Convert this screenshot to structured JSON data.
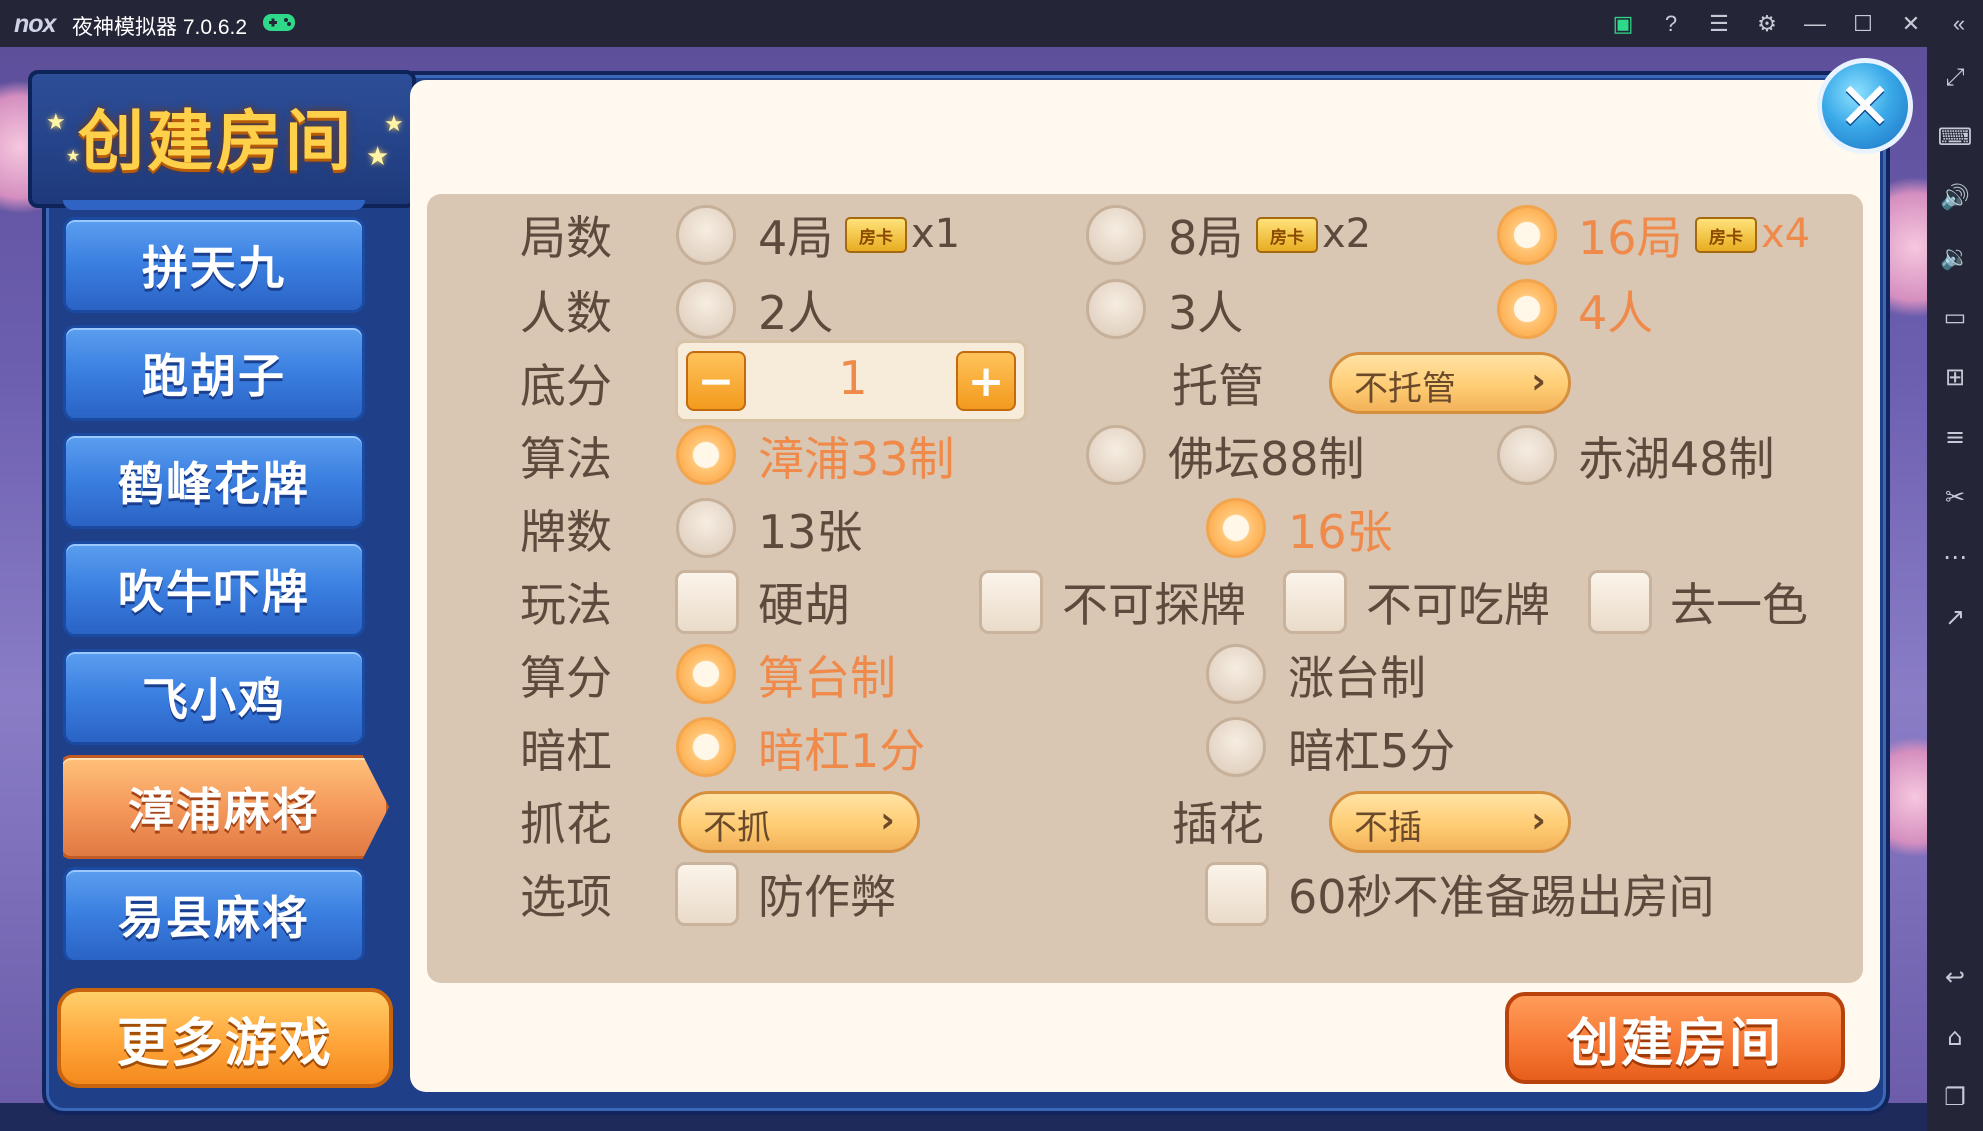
{
  "window": {
    "logo": "nox",
    "title": "夜神模拟器 7.0.6.2",
    "title_icons": [
      "gamepad-icon"
    ],
    "toolbar_icons": [
      "app-center-icon",
      "help-icon",
      "menu-icon",
      "settings-icon",
      "minimize-icon",
      "maximize-icon",
      "close-icon",
      "collapse-icon"
    ]
  },
  "sidebar": {
    "icons": [
      "fullscreen-icon",
      "keyboard-icon",
      "volume-up-icon",
      "volume-down-icon",
      "screen-icon",
      "apk-install-icon",
      "multi-instance-icon",
      "scissors-icon",
      "more-icon",
      "export-icon",
      "back-icon",
      "home-icon",
      "recent-apps-icon"
    ]
  },
  "dialog": {
    "title": "创建房间",
    "close_icon": "close-x-icon",
    "games": [
      {
        "label": "拼天九"
      },
      {
        "label": "跑胡子"
      },
      {
        "label": "鹤峰花牌"
      },
      {
        "label": "吹牛吓牌"
      },
      {
        "label": "飞小鸡"
      },
      {
        "label": "漳浦麻将",
        "active": true
      },
      {
        "label": "易县麻将"
      }
    ],
    "more_games": "更多游戏",
    "create_button": "创建房间",
    "card_label": "房卡",
    "rows": {
      "rounds": {
        "label": "局数",
        "options": [
          {
            "text": "4局",
            "cost": "x1",
            "selected": false
          },
          {
            "text": "8局",
            "cost": "x2",
            "selected": false
          },
          {
            "text": "16局",
            "cost": "x4",
            "selected": true
          }
        ]
      },
      "players": {
        "label": "人数",
        "options": [
          {
            "text": "2人",
            "selected": false
          },
          {
            "text": "3人",
            "selected": false
          },
          {
            "text": "4人",
            "selected": true
          }
        ]
      },
      "base_score": {
        "label": "底分",
        "value": "1",
        "minus": "−",
        "plus": "+"
      },
      "auto_play": {
        "label": "托管",
        "value": "不托管",
        "arrow": "›"
      },
      "rule": {
        "label": "算法",
        "options": [
          {
            "text": "漳浦33制",
            "selected": true
          },
          {
            "text": "佛坛88制",
            "selected": false
          },
          {
            "text": "赤湖48制",
            "selected": false
          }
        ]
      },
      "tiles": {
        "label": "牌数",
        "options": [
          {
            "text": "13张",
            "selected": false
          },
          {
            "text": "16张",
            "selected": true
          }
        ]
      },
      "play": {
        "label": "玩法",
        "options": [
          {
            "text": "硬胡",
            "checked": false
          },
          {
            "text": "不可探牌",
            "checked": false
          },
          {
            "text": "不可吃牌",
            "checked": false
          },
          {
            "text": "去一色",
            "checked": false
          }
        ]
      },
      "scoring": {
        "label": "算分",
        "options": [
          {
            "text": "算台制",
            "selected": true
          },
          {
            "text": "涨台制",
            "selected": false
          }
        ]
      },
      "hidden_kong": {
        "label": "暗杠",
        "options": [
          {
            "text": "暗杠1分",
            "selected": true
          },
          {
            "text": "暗杠5分",
            "selected": false
          }
        ]
      },
      "draw_flower": {
        "label": "抓花",
        "value": "不抓",
        "arrow": "›"
      },
      "insert_flower": {
        "label": "插花",
        "value": "不插",
        "arrow": "›"
      },
      "options": {
        "label": "选项",
        "options": [
          {
            "text": "防作弊",
            "checked": false
          },
          {
            "text": "60秒不准备踢出房间",
            "checked": false
          }
        ]
      }
    }
  },
  "colors": {
    "accent_orange": "#f08a4a",
    "text_brown": "#5e4a3c",
    "panel_bg": "#d9c6b3",
    "frame_blue": "#1f3f88"
  }
}
